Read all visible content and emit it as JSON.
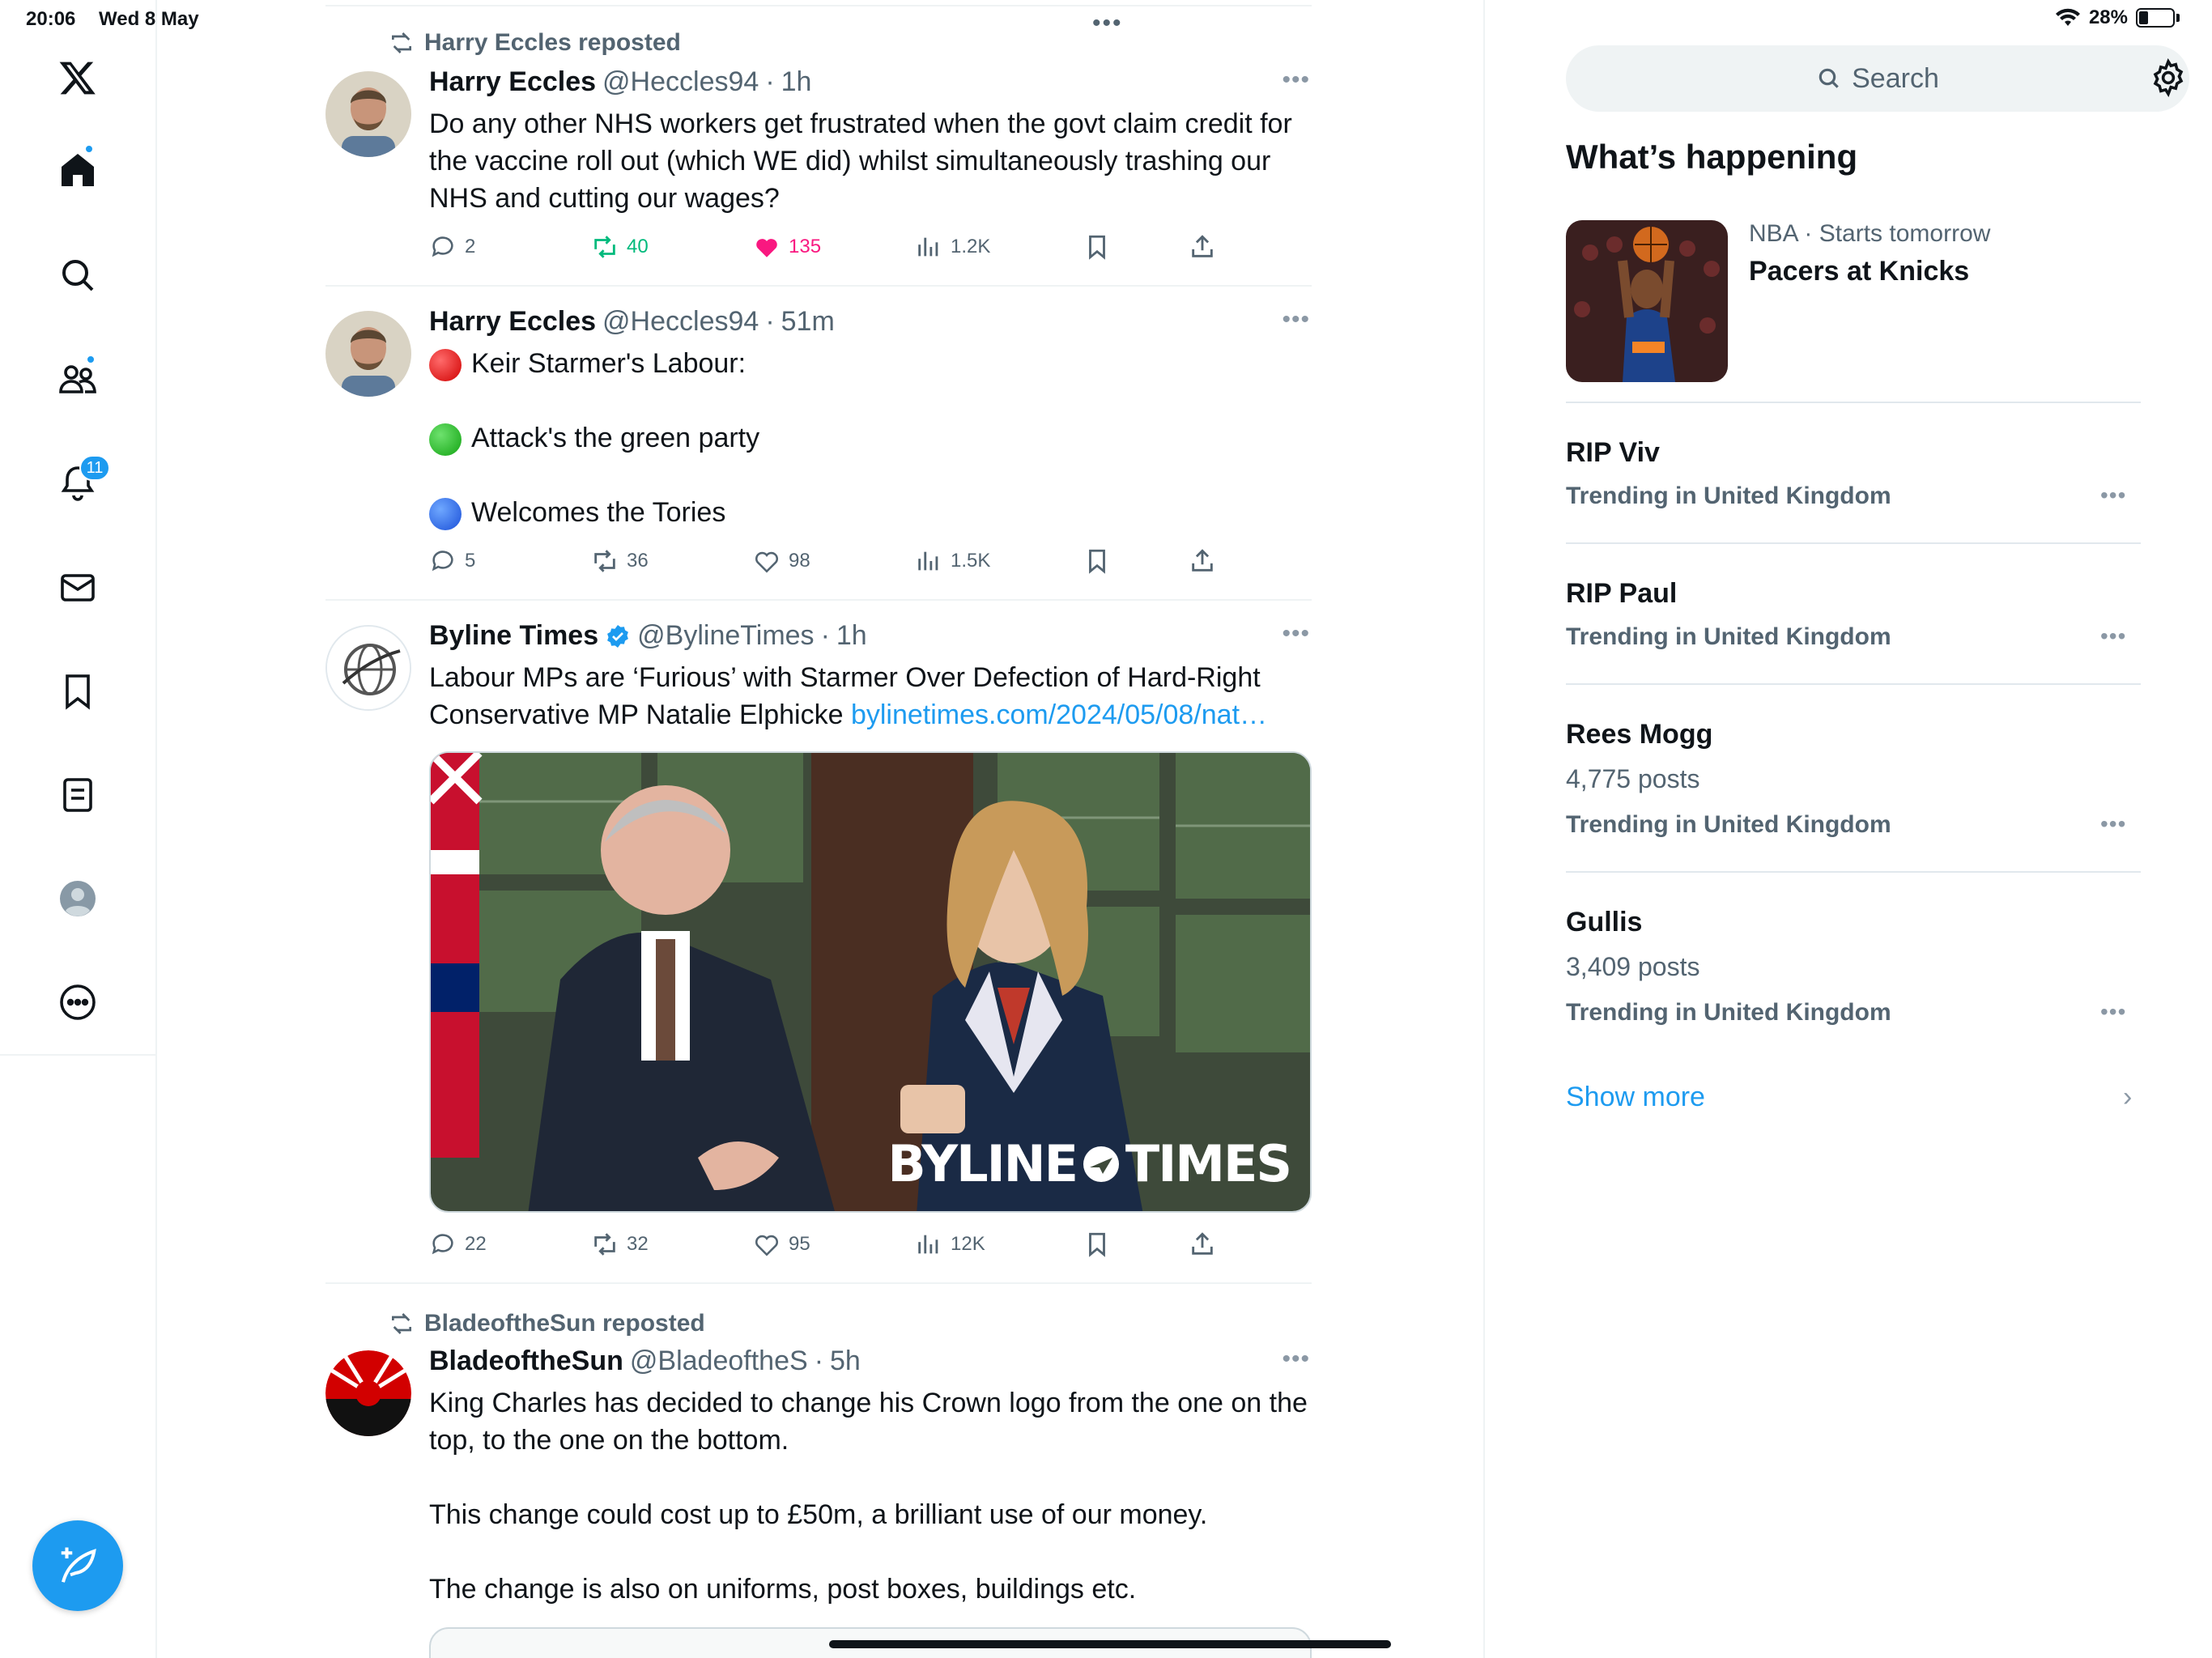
{
  "status_bar": {
    "time": "20:06",
    "date": "Wed 8 May",
    "battery": "28%",
    "battery_level": 0.28
  },
  "nav": {
    "items": [
      {
        "name": "x-logo-icon"
      },
      {
        "name": "home-icon",
        "has_dot": true
      },
      {
        "name": "search-icon"
      },
      {
        "name": "communities-icon",
        "has_dot": true
      },
      {
        "name": "notifications-icon",
        "badge": "11"
      },
      {
        "name": "messages-icon"
      },
      {
        "name": "bookmarks-icon"
      },
      {
        "name": "lists-icon"
      },
      {
        "name": "profile-icon"
      },
      {
        "name": "more-icon"
      }
    ],
    "compose_icon": "compose-icon"
  },
  "colors": {
    "accent": "#1d9bf0",
    "retweet_active": "#00ba7c",
    "like_active": "#f91880",
    "muted": "#536471"
  },
  "feed": {
    "tweets": [
      {
        "repost_label": "Harry Eccles reposted",
        "name": "Harry Eccles",
        "handle": "@Heccles94",
        "time": "1h",
        "text": "Do any other NHS workers get frustrated when the govt claim credit for the vaccine roll out (which WE did) whilst simultaneously trashing our NHS and cutting our wages?",
        "replies": "2",
        "retweets": "40",
        "likes": "135",
        "views": "1.2K",
        "retweeted": true,
        "liked": true
      },
      {
        "name": "Harry Eccles",
        "handle": "@Heccles94",
        "time": "51m",
        "line1": "Keir Starmer's Labour:",
        "line2": "Attack's the green party",
        "line3": "Welcomes the Tories",
        "replies": "5",
        "retweets": "36",
        "likes": "98",
        "views": "1.5K"
      },
      {
        "name": "Byline Times",
        "handle": "@BylineTimes",
        "time": "1h",
        "verified": true,
        "text": "Labour MPs are ‘Furious’ with Starmer Over Defection of Hard-Right Conservative MP Natalie Elphicke ",
        "link": "bylinetimes.com/2024/05/08/nat…",
        "media_watermark": "BYLINE",
        "media_watermark_2": "TIMES",
        "replies": "22",
        "retweets": "32",
        "likes": "95",
        "views": "12K"
      },
      {
        "repost_label": "BladeoftheSun reposted",
        "name": "BladeoftheSun",
        "handle": "@BladeoftheS",
        "time": "5h",
        "text": "King Charles has decided to change his Crown logo from the one on the top, to the one on the bottom.\n\nThis change could cost up to £50m, a brilliant use of our money.\n\nThe change is also on uniforms, post boxes, buildings etc."
      }
    ]
  },
  "sidebar": {
    "search_placeholder": "Search",
    "heading": "What’s happening",
    "event": {
      "category": "NBA",
      "when": "Starts tomorrow",
      "title": "Pacers at Knicks"
    },
    "trends": [
      {
        "title": "RIP Viv",
        "sub": "Trending in United Kingdom"
      },
      {
        "title": "RIP Paul",
        "sub": "Trending in United Kingdom"
      },
      {
        "title": "Rees Mogg",
        "count": "4,775 posts",
        "sub": "Trending in United Kingdom"
      },
      {
        "title": "Gullis",
        "count": "3,409 posts",
        "sub": "Trending in United Kingdom"
      }
    ],
    "show_more": "Show more"
  }
}
